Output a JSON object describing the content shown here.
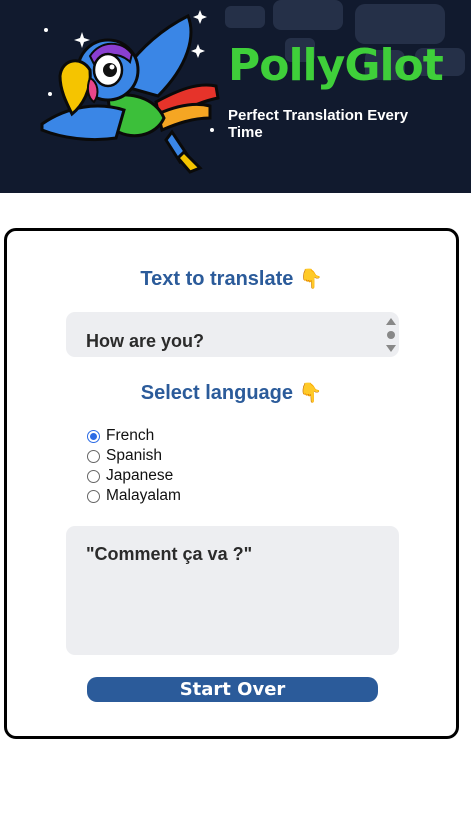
{
  "header": {
    "brand": "PollyGlot",
    "tagline": "Perfect Translation Every Time"
  },
  "translate": {
    "heading": "Text to translate",
    "heading_emoji": "👇",
    "input_value": "How are you?"
  },
  "language": {
    "heading": "Select language",
    "heading_emoji": "👇",
    "options": [
      "French",
      "Spanish",
      "Japanese",
      "Malayalam"
    ],
    "selected": "French"
  },
  "output": {
    "text": "\"Comment ça va ?\""
  },
  "actions": {
    "start_over_label": "Start Over"
  },
  "colors": {
    "header_bg": "#111a2e",
    "brand_green": "#3fcf3a",
    "heading_blue": "#2b5b9a",
    "field_bg": "#edeef1",
    "radio_blue": "#2b6be5"
  }
}
